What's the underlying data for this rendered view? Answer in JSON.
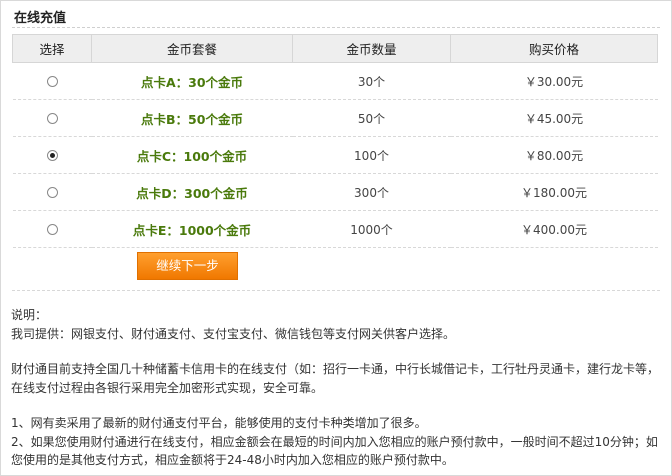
{
  "title": "在线充值",
  "table": {
    "headers": [
      "选择",
      "金币套餐",
      "金币数量",
      "购买价格"
    ],
    "rows": [
      {
        "package": "点卡A：30个金币",
        "count": "30个",
        "price": "￥30.00元",
        "selected": false
      },
      {
        "package": "点卡B：50个金币",
        "count": "50个",
        "price": "￥45.00元",
        "selected": false
      },
      {
        "package": "点卡C：100个金币",
        "count": "100个",
        "price": "￥80.00元",
        "selected": true
      },
      {
        "package": "点卡D：300个金币",
        "count": "300个",
        "price": "￥180.00元",
        "selected": false
      },
      {
        "package": "点卡E：1000个金币",
        "count": "1000个",
        "price": "￥400.00元",
        "selected": false
      }
    ]
  },
  "next_button": "继续下一步",
  "notes": {
    "heading": "说明：",
    "providers": "我司提供：网银支付、财付通支付、支付宝支付、微信钱包等支付网关供客户选择。",
    "tenpay": "财付通目前支持全国几十种储蓄卡信用卡的在线支付（如：招行一卡通，中行长城借记卡，工行牡丹灵通卡，建行龙卡等，在线支付过程由各银行采用完全加密形式实现，安全可靠。",
    "point1": "1、网有卖采用了最新的财付通支付平台，能够使用的支付卡种类增加了很多。",
    "point2": "2、如果您使用财付通进行在线支付，相应金额会在最短的时间内加入您相应的账户预付款中，一般时间不超过10分钟；如您使用的是其他支付方式，相应金额将于24-48小时内加入您相应的账户预付款中。"
  }
}
